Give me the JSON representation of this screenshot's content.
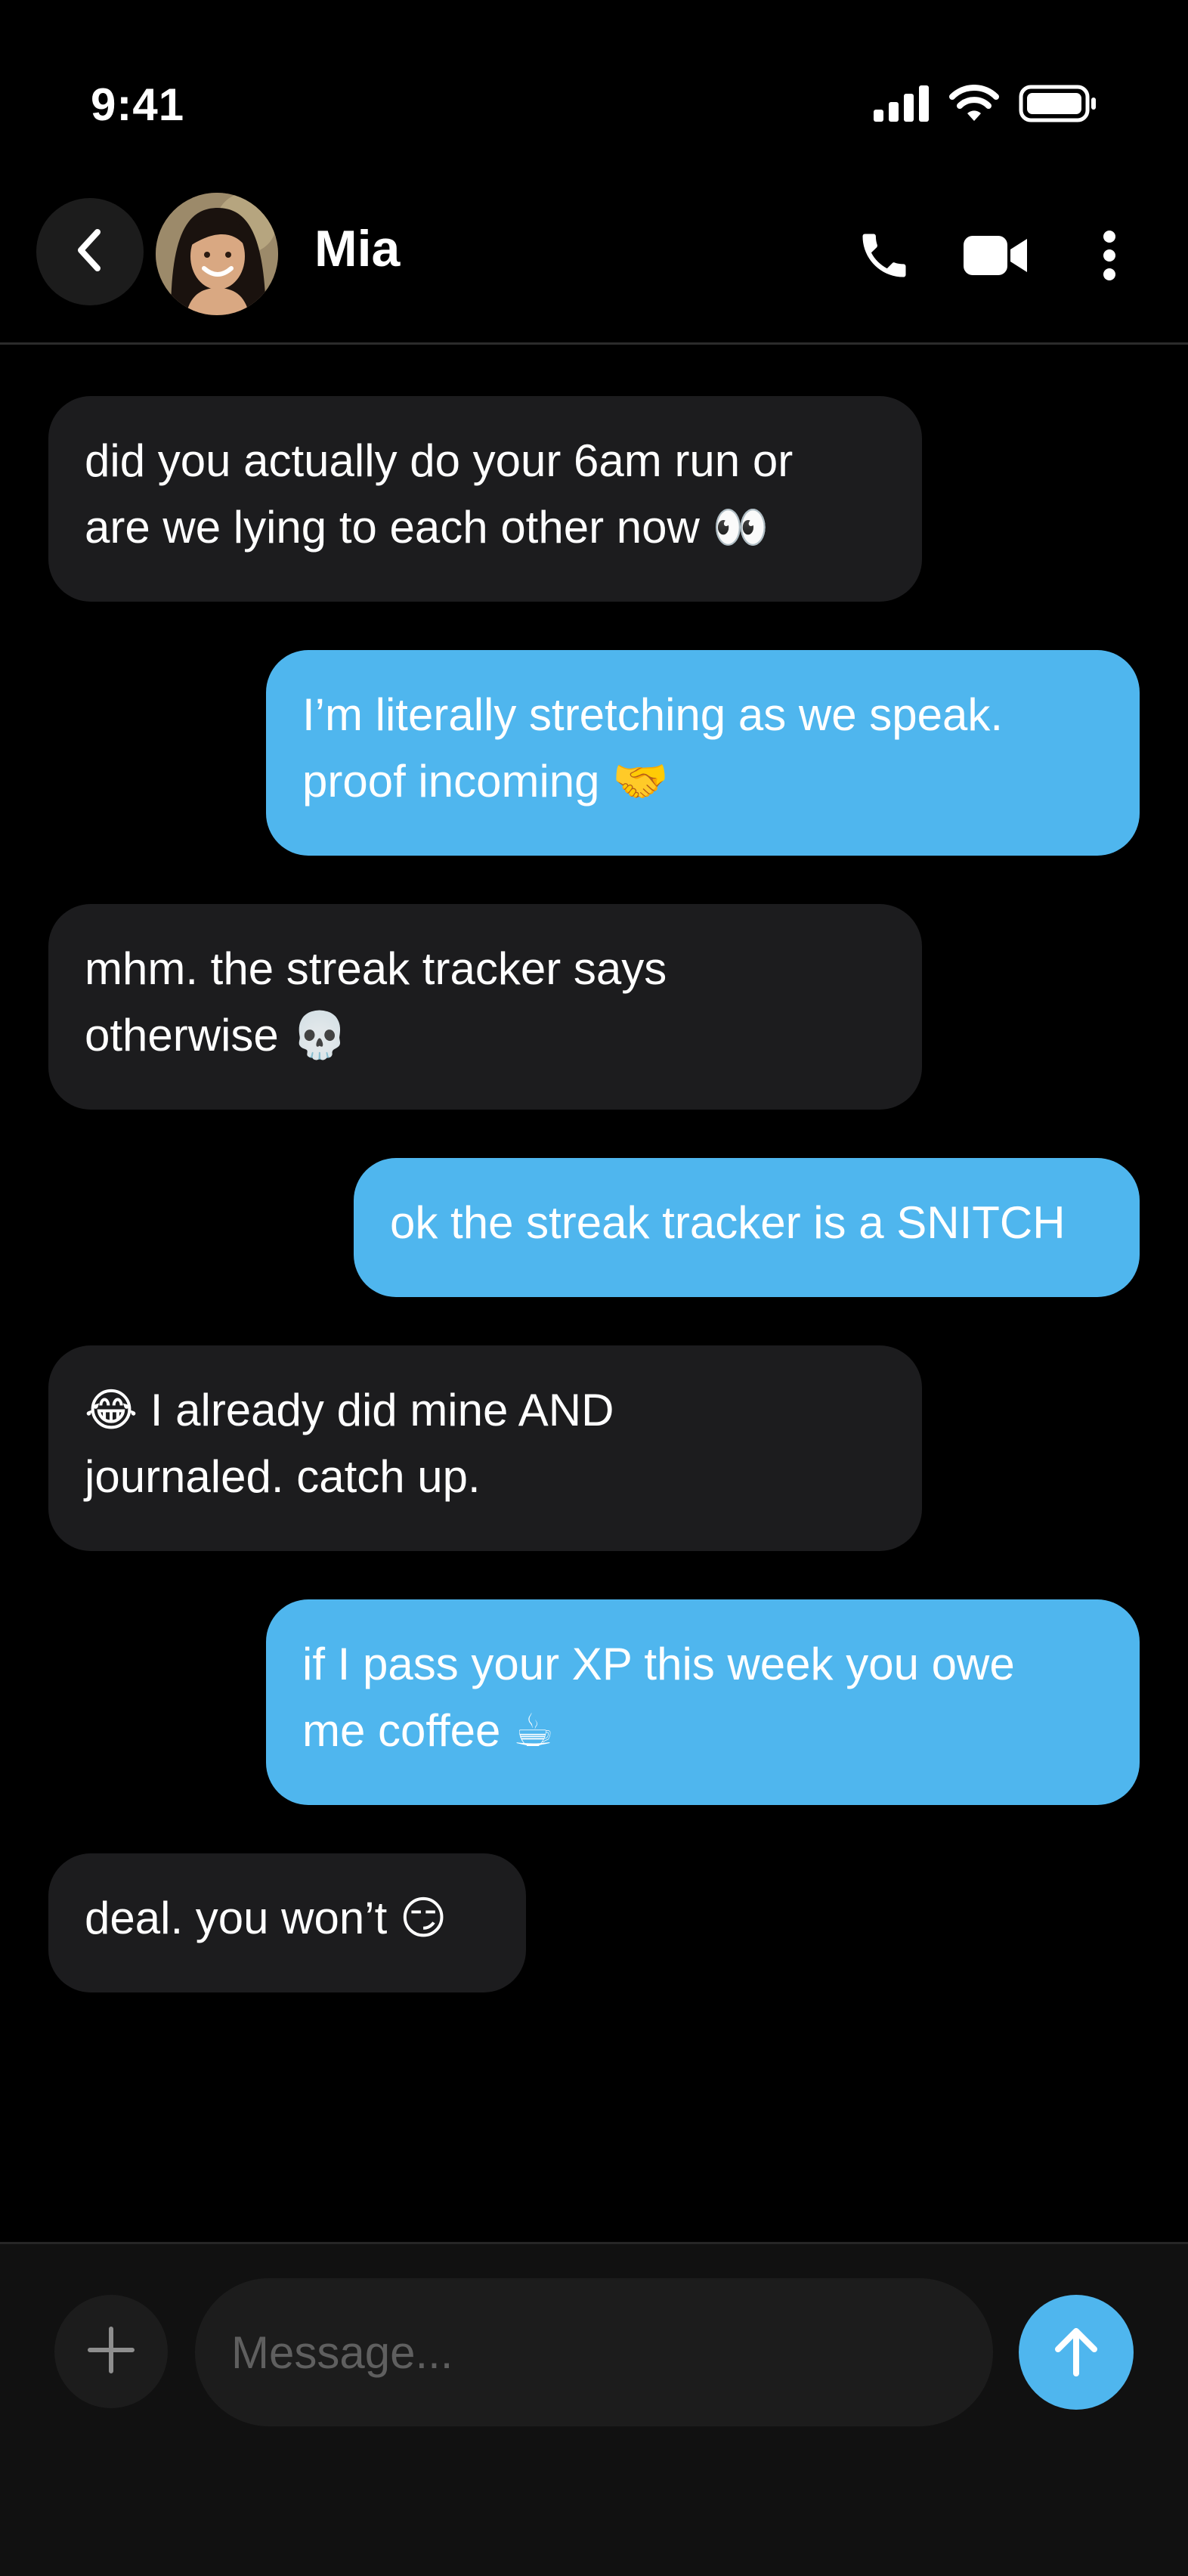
{
  "status_bar": {
    "time": "9:41",
    "icons": [
      "signal-icon",
      "wifi-icon",
      "battery-icon"
    ]
  },
  "header": {
    "contact_name": "Mia",
    "icons": [
      "back-chevron-icon",
      "phone-icon",
      "video-camera-icon",
      "more-vertical-icon"
    ]
  },
  "messages": [
    {
      "direction": "incoming",
      "lines": [
        "did you actually do your 6am run or",
        "are we lying to each other now 👀"
      ]
    },
    {
      "direction": "outgoing",
      "lines": [
        "I’m literally stretching as we speak.",
        "proof incoming 🤝"
      ]
    },
    {
      "direction": "incoming",
      "lines": [
        "mhm. the streak tracker says",
        "otherwise 💀"
      ]
    },
    {
      "direction": "outgoing",
      "lines": [
        "ok the streak tracker is a SNITCH"
      ]
    },
    {
      "direction": "incoming",
      "lines": [
        "😂  I already did mine AND",
        "journaled. catch up."
      ]
    },
    {
      "direction": "outgoing",
      "lines": [
        "if I pass your XP this week you owe",
        "me coffee ☕"
      ]
    },
    {
      "direction": "incoming",
      "lines": [
        "deal. you won’t 😏"
      ]
    }
  ],
  "composer": {
    "placeholder": "Message...",
    "value": "",
    "icons": [
      "plus-icon",
      "send-arrow-up-icon"
    ]
  },
  "colors": {
    "background": "#000000",
    "incoming_bubble": "#1c1c1e",
    "outgoing_bubble": "#4fb6ee",
    "send_button": "#4fb6ee"
  }
}
